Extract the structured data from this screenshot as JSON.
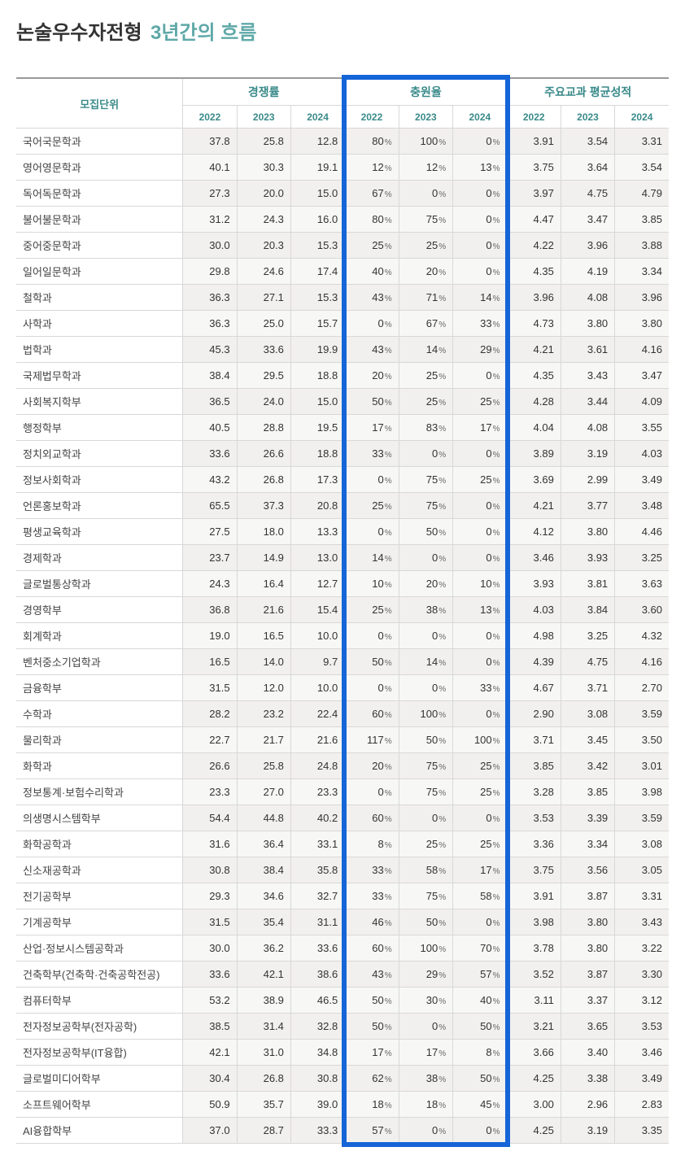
{
  "title_main": "논술우수자전형",
  "title_sub": "3년간의 흐름",
  "headers": {
    "dept": "모집단위",
    "comp": "경쟁률",
    "fill": "충원율",
    "score": "주요교과 평균성적",
    "y2022": "2022",
    "y2023": "2023",
    "y2024": "2024"
  },
  "rows": [
    {
      "dept": "국어국문학과",
      "c": [
        37.8,
        25.8,
        12.8
      ],
      "f": [
        80,
        100,
        0
      ],
      "s": [
        3.91,
        3.54,
        3.31
      ]
    },
    {
      "dept": "영어영문학과",
      "c": [
        40.1,
        30.3,
        19.1
      ],
      "f": [
        12,
        12,
        13
      ],
      "s": [
        3.75,
        3.64,
        3.54
      ]
    },
    {
      "dept": "독어독문학과",
      "c": [
        27.3,
        20.0,
        15.0
      ],
      "f": [
        67,
        0,
        0
      ],
      "s": [
        3.97,
        4.75,
        4.79
      ]
    },
    {
      "dept": "불어불문학과",
      "c": [
        31.2,
        24.3,
        16.0
      ],
      "f": [
        80,
        75,
        0
      ],
      "s": [
        4.47,
        3.47,
        3.85
      ]
    },
    {
      "dept": "중어중문학과",
      "c": [
        30.0,
        20.3,
        15.3
      ],
      "f": [
        25,
        25,
        0
      ],
      "s": [
        4.22,
        3.96,
        3.88
      ]
    },
    {
      "dept": "일어일문학과",
      "c": [
        29.8,
        24.6,
        17.4
      ],
      "f": [
        40,
        20,
        0
      ],
      "s": [
        4.35,
        4.19,
        3.34
      ]
    },
    {
      "dept": "철학과",
      "c": [
        36.3,
        27.1,
        15.3
      ],
      "f": [
        43,
        71,
        14
      ],
      "s": [
        3.96,
        4.08,
        3.96
      ]
    },
    {
      "dept": "사학과",
      "c": [
        36.3,
        25.0,
        15.7
      ],
      "f": [
        0,
        67,
        33
      ],
      "s": [
        4.73,
        3.8,
        3.8
      ]
    },
    {
      "dept": "법학과",
      "c": [
        45.3,
        33.6,
        19.9
      ],
      "f": [
        43,
        14,
        29
      ],
      "s": [
        4.21,
        3.61,
        4.16
      ]
    },
    {
      "dept": "국제법무학과",
      "c": [
        38.4,
        29.5,
        18.8
      ],
      "f": [
        20,
        25,
        0
      ],
      "s": [
        4.35,
        3.43,
        3.47
      ]
    },
    {
      "dept": "사회복지학부",
      "c": [
        36.5,
        24.0,
        15.0
      ],
      "f": [
        50,
        25,
        25
      ],
      "s": [
        4.28,
        3.44,
        4.09
      ]
    },
    {
      "dept": "행정학부",
      "c": [
        40.5,
        28.8,
        19.5
      ],
      "f": [
        17,
        83,
        17
      ],
      "s": [
        4.04,
        4.08,
        3.55
      ]
    },
    {
      "dept": "정치외교학과",
      "c": [
        33.6,
        26.6,
        18.8
      ],
      "f": [
        33,
        0,
        0
      ],
      "s": [
        3.89,
        3.19,
        4.03
      ]
    },
    {
      "dept": "정보사회학과",
      "c": [
        43.2,
        26.8,
        17.3
      ],
      "f": [
        0,
        75,
        25
      ],
      "s": [
        3.69,
        2.99,
        3.49
      ]
    },
    {
      "dept": "언론홍보학과",
      "c": [
        65.5,
        37.3,
        20.8
      ],
      "f": [
        25,
        75,
        0
      ],
      "s": [
        4.21,
        3.77,
        3.48
      ]
    },
    {
      "dept": "평생교육학과",
      "c": [
        27.5,
        18.0,
        13.3
      ],
      "f": [
        0,
        50,
        0
      ],
      "s": [
        4.12,
        3.8,
        4.46
      ]
    },
    {
      "dept": "경제학과",
      "c": [
        23.7,
        14.9,
        13.0
      ],
      "f": [
        14,
        0,
        0
      ],
      "s": [
        3.46,
        3.93,
        3.25
      ]
    },
    {
      "dept": "글로벌통상학과",
      "c": [
        24.3,
        16.4,
        12.7
      ],
      "f": [
        10,
        20,
        10
      ],
      "s": [
        3.93,
        3.81,
        3.63
      ]
    },
    {
      "dept": "경영학부",
      "c": [
        36.8,
        21.6,
        15.4
      ],
      "f": [
        25,
        38,
        13
      ],
      "s": [
        4.03,
        3.84,
        3.6
      ]
    },
    {
      "dept": "회계학과",
      "c": [
        19.0,
        16.5,
        10.0
      ],
      "f": [
        0,
        0,
        0
      ],
      "s": [
        4.98,
        3.25,
        4.32
      ]
    },
    {
      "dept": "벤처중소기업학과",
      "c": [
        16.5,
        14.0,
        9.7
      ],
      "f": [
        50,
        14,
        0
      ],
      "s": [
        4.39,
        4.75,
        4.16
      ]
    },
    {
      "dept": "금융학부",
      "c": [
        31.5,
        12.0,
        10.0
      ],
      "f": [
        0,
        0,
        33
      ],
      "s": [
        4.67,
        3.71,
        2.7
      ]
    },
    {
      "dept": "수학과",
      "c": [
        28.2,
        23.2,
        22.4
      ],
      "f": [
        60,
        100,
        0
      ],
      "s": [
        2.9,
        3.08,
        3.59
      ]
    },
    {
      "dept": "물리학과",
      "c": [
        22.7,
        21.7,
        21.6
      ],
      "f": [
        117,
        50,
        100
      ],
      "s": [
        3.71,
        3.45,
        3.5
      ]
    },
    {
      "dept": "화학과",
      "c": [
        26.6,
        25.8,
        24.8
      ],
      "f": [
        20,
        75,
        25
      ],
      "s": [
        3.85,
        3.42,
        3.01
      ]
    },
    {
      "dept": "정보통계·보험수리학과",
      "c": [
        23.3,
        27.0,
        23.3
      ],
      "f": [
        0,
        75,
        25
      ],
      "s": [
        3.28,
        3.85,
        3.98
      ]
    },
    {
      "dept": "의생명시스템학부",
      "c": [
        54.4,
        44.8,
        40.2
      ],
      "f": [
        60,
        0,
        0
      ],
      "s": [
        3.53,
        3.39,
        3.59
      ]
    },
    {
      "dept": "화학공학과",
      "c": [
        31.6,
        36.4,
        33.1
      ],
      "f": [
        8,
        25,
        25
      ],
      "s": [
        3.36,
        3.34,
        3.08
      ]
    },
    {
      "dept": "신소재공학과",
      "c": [
        30.8,
        38.4,
        35.8
      ],
      "f": [
        33,
        58,
        17
      ],
      "s": [
        3.75,
        3.56,
        3.05
      ]
    },
    {
      "dept": "전기공학부",
      "c": [
        29.3,
        34.6,
        32.7
      ],
      "f": [
        33,
        75,
        58
      ],
      "s": [
        3.91,
        3.87,
        3.31
      ]
    },
    {
      "dept": "기계공학부",
      "c": [
        31.5,
        35.4,
        31.1
      ],
      "f": [
        46,
        50,
        0
      ],
      "s": [
        3.98,
        3.8,
        3.43
      ]
    },
    {
      "dept": "산업·정보시스템공학과",
      "c": [
        30.0,
        36.2,
        33.6
      ],
      "f": [
        60,
        100,
        70
      ],
      "s": [
        3.78,
        3.8,
        3.22
      ]
    },
    {
      "dept": "건축학부(건축학·건축공학전공)",
      "c": [
        33.6,
        42.1,
        38.6
      ],
      "f": [
        43,
        29,
        57
      ],
      "s": [
        3.52,
        3.87,
        3.3
      ]
    },
    {
      "dept": "컴퓨터학부",
      "c": [
        53.2,
        38.9,
        46.5
      ],
      "f": [
        50,
        30,
        40
      ],
      "s": [
        3.11,
        3.37,
        3.12
      ]
    },
    {
      "dept": "전자정보공학부(전자공학)",
      "c": [
        38.5,
        31.4,
        32.8
      ],
      "f": [
        50,
        0,
        50
      ],
      "s": [
        3.21,
        3.65,
        3.53
      ]
    },
    {
      "dept": "전자정보공학부(IT융합)",
      "c": [
        42.1,
        31.0,
        34.8
      ],
      "f": [
        17,
        17,
        8
      ],
      "s": [
        3.66,
        3.4,
        3.46
      ]
    },
    {
      "dept": "글로벌미디어학부",
      "c": [
        30.4,
        26.8,
        30.8
      ],
      "f": [
        62,
        38,
        50
      ],
      "s": [
        4.25,
        3.38,
        3.49
      ]
    },
    {
      "dept": "소프트웨어학부",
      "c": [
        50.9,
        35.7,
        39.0
      ],
      "f": [
        18,
        18,
        45
      ],
      "s": [
        3.0,
        2.96,
        2.83
      ]
    },
    {
      "dept": "AI융합학부",
      "c": [
        37.0,
        28.7,
        33.3
      ],
      "f": [
        57,
        0,
        0
      ],
      "s": [
        4.25,
        3.19,
        3.35
      ]
    }
  ]
}
